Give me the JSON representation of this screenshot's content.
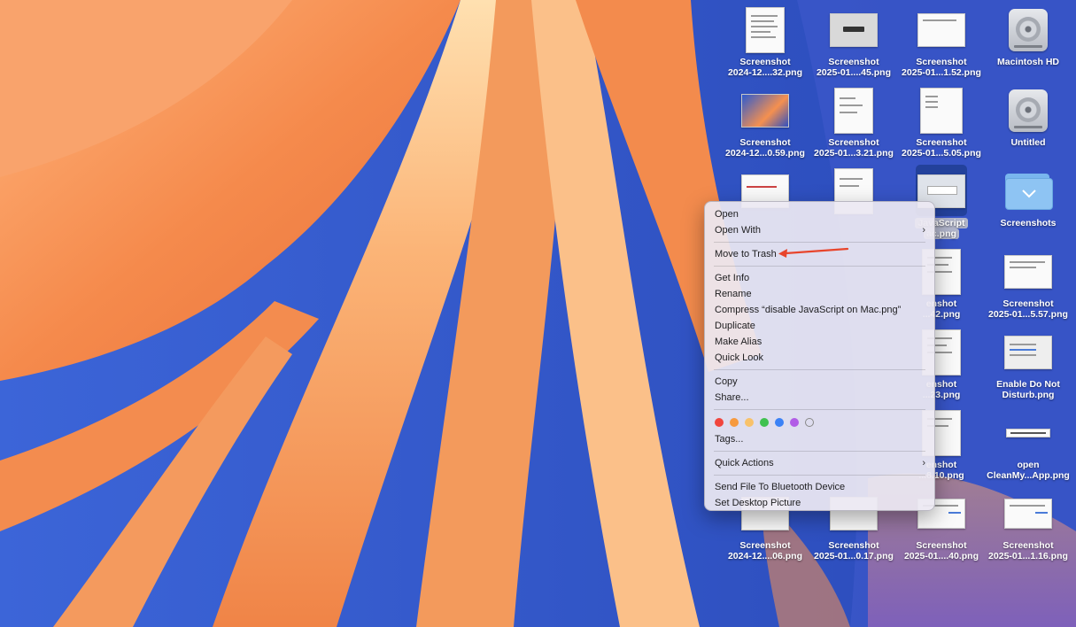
{
  "desktop_icons": [
    {
      "id": "r1c1",
      "line1": "Screenshot",
      "line2": "2024-12....32.png",
      "kind": "doc-portrait"
    },
    {
      "id": "r1c2",
      "line1": "Screenshot",
      "line2": "2025-01....45.png",
      "kind": "doc-dialog"
    },
    {
      "id": "r1c3",
      "line1": "Screenshot",
      "line2": "2025-01...1.52.png",
      "kind": "doc-land"
    },
    {
      "id": "r1c4",
      "line1": "Macintosh HD",
      "line2": "",
      "kind": "drive"
    },
    {
      "id": "r2c1",
      "line1": "Screenshot",
      "line2": "2024-12...0.59.png",
      "kind": "doc-wallpaper"
    },
    {
      "id": "r2c2",
      "line1": "Screenshot",
      "line2": "2025-01...3.21.png",
      "kind": "doc-portrait"
    },
    {
      "id": "r2c3",
      "line1": "Screenshot",
      "line2": "2025-01...5.05.png",
      "kind": "doc-land"
    },
    {
      "id": "r2c4",
      "line1": "Untitled",
      "line2": "",
      "kind": "drive"
    },
    {
      "id": "r3c1",
      "line1": "",
      "line2": "",
      "kind": "doc-land"
    },
    {
      "id": "r3c2",
      "line1": "",
      "line2": "",
      "kind": "doc-portrait"
    },
    {
      "id": "r3c3",
      "line1": "JavaScript",
      "line2": "ac.png",
      "kind": "doc-selected"
    },
    {
      "id": "r3c4",
      "line1": "Screenshots",
      "line2": "",
      "kind": "folder"
    },
    {
      "id": "r4c3",
      "line1": "enshot",
      "line2": "...42.png",
      "kind": "doc-portrait"
    },
    {
      "id": "r4c4",
      "line1": "Screenshot",
      "line2": "2025-01...5.57.png",
      "kind": "doc-land"
    },
    {
      "id": "r5c3",
      "line1": "enshot",
      "line2": "...23.png",
      "kind": "doc-portrait"
    },
    {
      "id": "r5c4",
      "line1": "Enable Do Not",
      "line2": "Disturb.png",
      "kind": "doc-land"
    },
    {
      "id": "r6c3",
      "line1": "enshot",
      "line2": "...8.10.png",
      "kind": "doc-portrait"
    },
    {
      "id": "r6c4",
      "line1": "open",
      "line2": "CleanMy...App.png",
      "kind": "doc-strip"
    },
    {
      "id": "r7c1",
      "line1": "Screenshot",
      "line2": "2024-12....06.png",
      "kind": "doc-land"
    },
    {
      "id": "r7c2",
      "line1": "Screenshot",
      "line2": "2025-01...0.17.png",
      "kind": "doc-land"
    },
    {
      "id": "r7c3",
      "line1": "Screenshot",
      "line2": "2025-01....40.png",
      "kind": "doc-wide"
    },
    {
      "id": "r7c4",
      "line1": "Screenshot",
      "line2": "2025-01...1.16.png",
      "kind": "doc-wide"
    }
  ],
  "context_menu": {
    "open": "Open",
    "open_with": "Open With",
    "move_to_trash": "Move to Trash",
    "get_info": "Get Info",
    "rename": "Rename",
    "compress": "Compress “disable JavaScript on Mac.png”",
    "duplicate": "Duplicate",
    "make_alias": "Make Alias",
    "quick_look": "Quick Look",
    "copy": "Copy",
    "share": "Share...",
    "tags": "Tags...",
    "quick_actions": "Quick Actions",
    "send_bluetooth": "Send File To Bluetooth Device",
    "set_desktop_picture": "Set Desktop Picture",
    "submenu_chevron": "›",
    "tag_colors": [
      "#f1453d",
      "#f79a3e",
      "#f8c26a",
      "#3fc14f",
      "#3b82f6",
      "#b15ce6",
      "none"
    ]
  },
  "annotation": {
    "arrow_color": "#e8452c"
  }
}
